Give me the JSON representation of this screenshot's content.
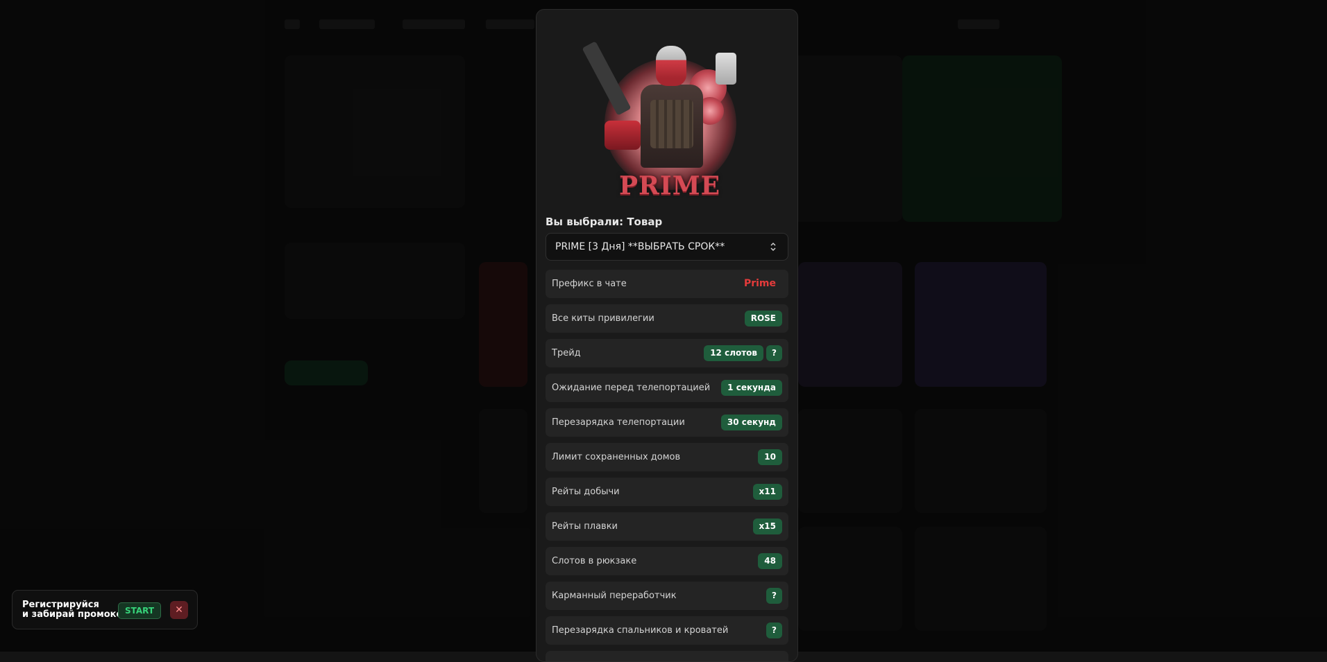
{
  "modal": {
    "selected_label": "Вы выбрали: Товар",
    "select_value": "PRIME [3 Дня] **ВЫБРАТЬ СРОК**",
    "logo_text": "PRIME",
    "features": [
      {
        "label": "Префикс в чате",
        "value": "Prime",
        "style": "text-red"
      },
      {
        "label": "Все киты привилегии",
        "value": "ROSE"
      },
      {
        "label": "Трейд",
        "value": "12 слотов",
        "help": "?"
      },
      {
        "label": "Ожидание перед телепортацией",
        "value": "1 секунда"
      },
      {
        "label": "Перезарядка телепортации",
        "value": "30 секунд"
      },
      {
        "label": "Лимит сохраненных домов",
        "value": "10"
      },
      {
        "label": "Рейты добычи",
        "value": "x11"
      },
      {
        "label": "Рейты плавки",
        "value": "x15"
      },
      {
        "label": "Слотов в рюкзаке",
        "value": "48"
      },
      {
        "label": "Карманный переработчик",
        "value": "?"
      },
      {
        "label": "Перезарядка спальников и кроватей",
        "value": "?"
      }
    ]
  },
  "toast": {
    "line1": "Регистрируйся",
    "line2": "и забирай промокод",
    "start_label": "START",
    "close_label": "✕"
  },
  "colors": {
    "accent_green": "#1f5d3c",
    "prefix_red": "#e53b3b",
    "panel": "#1a1a1a"
  }
}
